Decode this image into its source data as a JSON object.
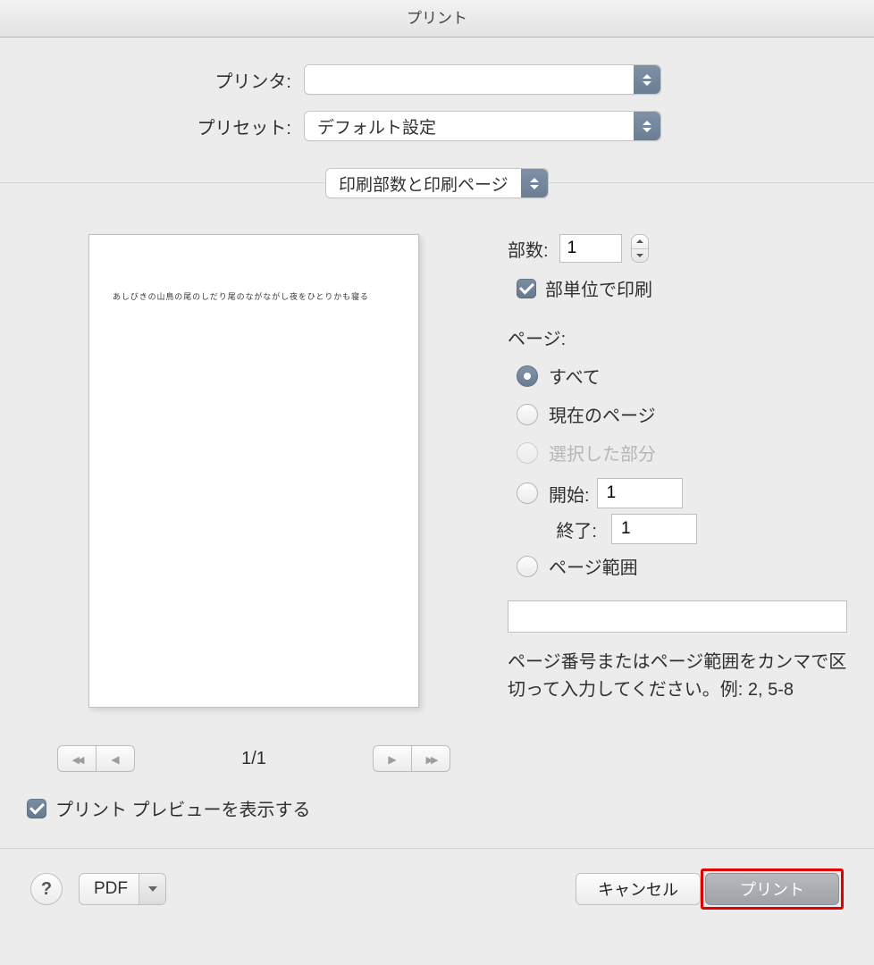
{
  "window": {
    "title": "プリント"
  },
  "printer": {
    "label": "プリンタ:",
    "value": ""
  },
  "preset": {
    "label": "プリセット:",
    "value": "デフォルト設定"
  },
  "panel_select": {
    "value": "印刷部数と印刷ページ"
  },
  "copies": {
    "label": "部数:",
    "value": "1",
    "collate_label": "部単位で印刷"
  },
  "pages": {
    "section_label": "ページ:",
    "all": "すべて",
    "current": "現在のページ",
    "selection": "選択した部分",
    "from_label": "開始:",
    "from_value": "1",
    "to_label": "終了:",
    "to_value": "1",
    "range_label": "ページ範囲",
    "range_value": "",
    "hint": "ページ番号またはページ範囲をカンマで区切って入力してください。例: 2, 5-8"
  },
  "preview": {
    "content": "あしびきの山鳥の尾のしだり尾のながながし夜をひとりかも寝る",
    "page_indicator": "1/1",
    "show_preview_label": "プリント プレビューを表示する"
  },
  "footer": {
    "pdf_label": "PDF",
    "cancel": "キャンセル",
    "print": "プリント"
  }
}
